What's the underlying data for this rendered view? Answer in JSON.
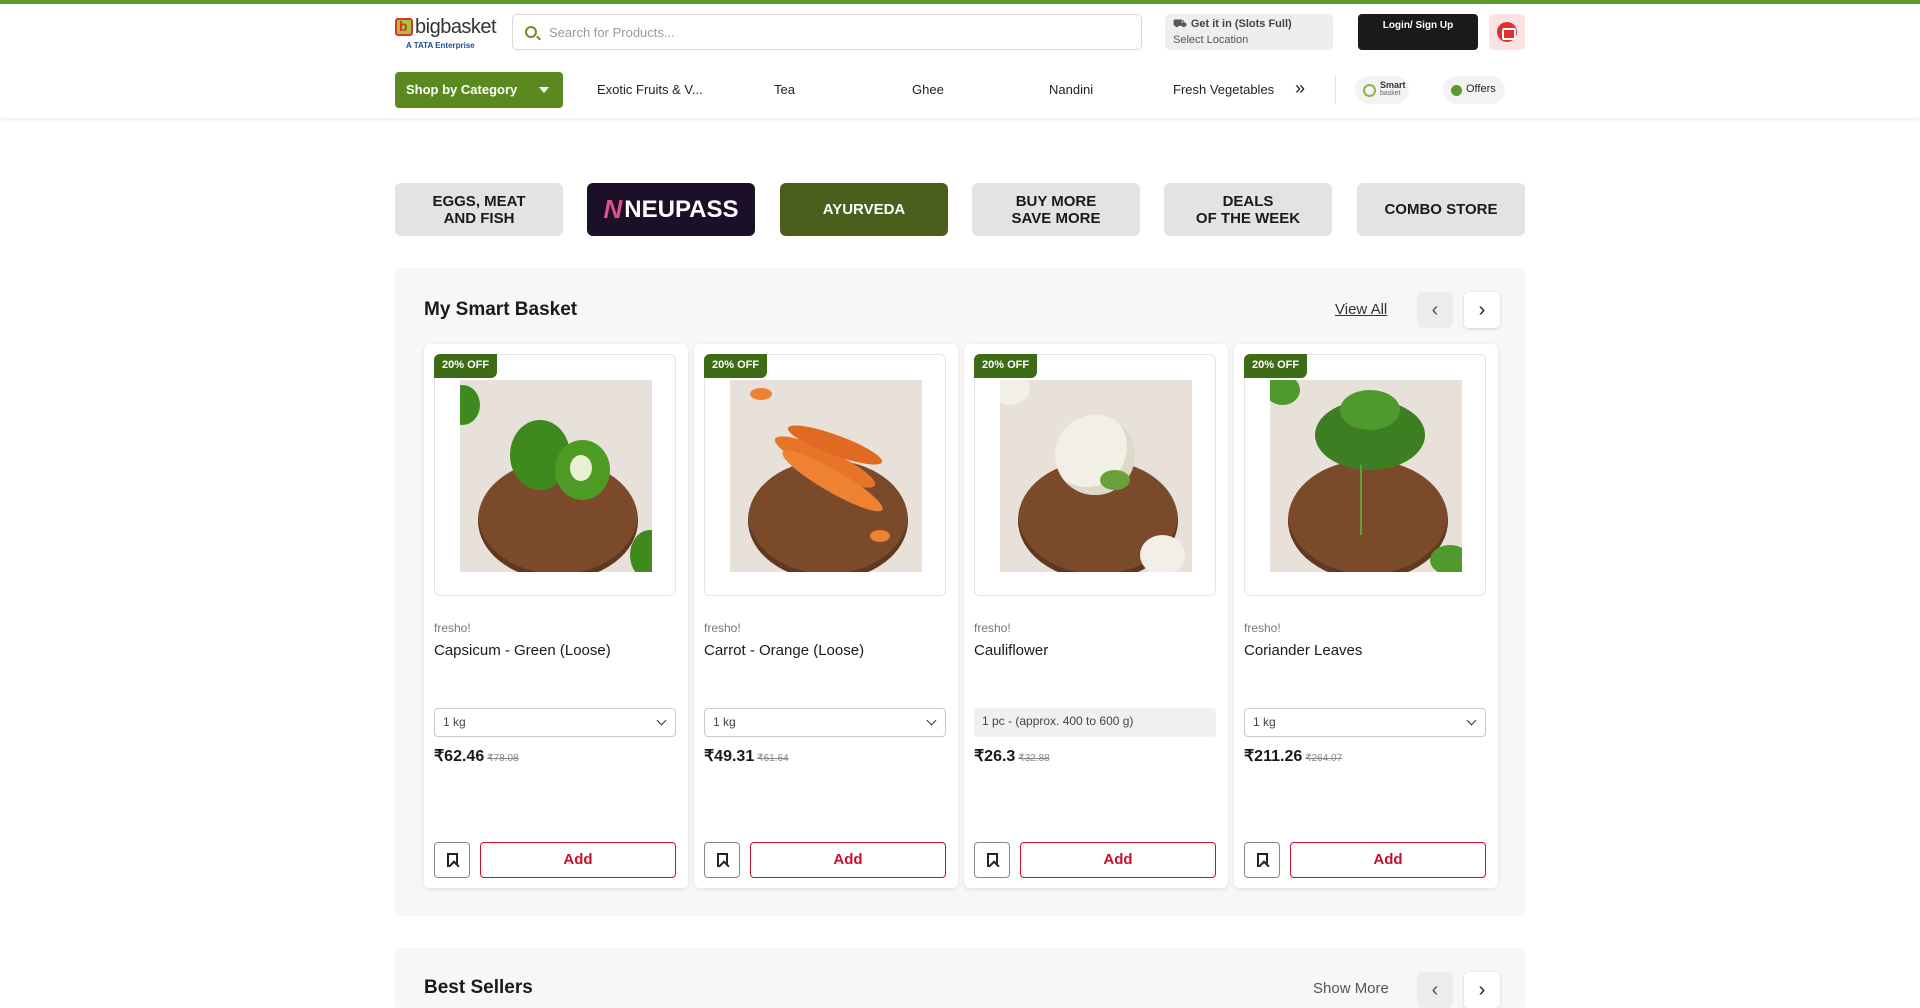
{
  "header": {
    "logo_name": "bigbasket",
    "logo_sub": "A TATA Enterprise",
    "search_placeholder": "Search for Products...",
    "location_line1": "Get it in (Slots Full)",
    "location_line2": "Select Location",
    "login_label": "Login/ Sign Up"
  },
  "nav": {
    "shop_by_category": "Shop by Category",
    "links": [
      "Exotic Fruits & V...",
      "Tea",
      "Ghee",
      "Nandini",
      "Fresh Vegetables"
    ],
    "more": "»",
    "smart_line1": "Smart",
    "smart_line2": "basket",
    "offers": "Offers"
  },
  "tiles": [
    "EGGS, MEAT\nAND FISH",
    "NEUPASS",
    "AYURVEDA",
    "BUY MORE\nSAVE MORE",
    "DEALS\nOF THE WEEK",
    "COMBO STORE"
  ],
  "smart_basket": {
    "title": "My Smart Basket",
    "view_all": "View All",
    "prev": "‹",
    "next": "›",
    "products": [
      {
        "badge": "20% OFF",
        "brand": "fresho!",
        "name": "Capsicum - Green (Loose)",
        "qty": "1 kg",
        "price": "₹62.46",
        "mrp": "₹78.08",
        "add": "Add"
      },
      {
        "badge": "20% OFF",
        "brand": "fresho!",
        "name": "Carrot - Orange (Loose)",
        "qty": "1 kg",
        "price": "₹49.31",
        "mrp": "₹61.64",
        "add": "Add"
      },
      {
        "badge": "20% OFF",
        "brand": "fresho!",
        "name": "Cauliflower",
        "qty": "1 pc - (approx. 400 to 600 g)",
        "price": "₹26.3",
        "mrp": "₹32.88",
        "add": "Add"
      },
      {
        "badge": "20% OFF",
        "brand": "fresho!",
        "name": "Coriander Leaves",
        "qty": "1 kg",
        "price": "₹211.26",
        "mrp": "₹264.07",
        "add": "Add"
      }
    ]
  },
  "best_sellers": {
    "title": "Best Sellers",
    "show_more": "Show More"
  },
  "colors": {
    "brand_green": "#5a8a1f",
    "accent_red": "#c8102e",
    "badge_green": "#3e6b16"
  }
}
